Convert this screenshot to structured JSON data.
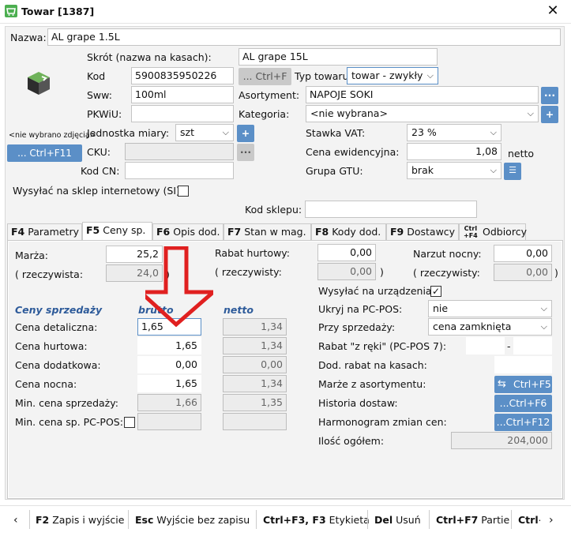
{
  "window": {
    "title": "Towar [1387]"
  },
  "header": {
    "name_label": "Nazwa:",
    "name_value": "AL grape 1.5L"
  },
  "general": {
    "shortname_label": "Skrót (nazwa na kasach):",
    "shortname_value": "AL grape 15L",
    "code_label": "Kod",
    "code_value": "5900835950226",
    "ctrlf_btn": "... Ctrl+F",
    "type_label": "Typ towaru:",
    "type_value": "towar - zwykły",
    "sww_label": "Sww:",
    "sww_value": "100ml",
    "assort_label": "Asortyment:",
    "assort_value": "NAPOJE SOKI",
    "pkwiu_label": "PKWiU:",
    "pkwiu_value": "",
    "category_label": "Kategoria:",
    "category_value": "<nie wybrana>",
    "no_image_text": "<nie wybrano zdjęcia>",
    "image_btn": "... Ctrl+F11",
    "unit_label": "Jednostka miary:",
    "unit_value": "szt",
    "vat_label": "Stawka VAT:",
    "vat_value": "23 %",
    "cku_label": "CKU:",
    "cku_value": "",
    "price_label": "Cena ewidencyjna:",
    "price_value": "1,08",
    "price_suffix": "netto",
    "cn_label": "Kod CN:",
    "cn_value": "",
    "gtu_label": "Grupa GTU:",
    "gtu_value": "brak",
    "ishop_label": "Wysyłać na sklep internetowy (SI):",
    "shopcode_label": "Kod sklepu:",
    "shopcode_value": "",
    "ellipsis": "...",
    "plus": "+"
  },
  "tabs": [
    {
      "key": "F4",
      "label": "Parametry"
    },
    {
      "key": "F5",
      "label": "Ceny sp."
    },
    {
      "key": "F6",
      "label": "Opis dod."
    },
    {
      "key": "F7",
      "label": "Stan w mag."
    },
    {
      "key": "F8",
      "label": "Kody dod."
    },
    {
      "key": "F9",
      "label": "Dostawcy"
    },
    {
      "key1": "Ctrl",
      "key2": "+F4",
      "label": "Odbiorcy"
    }
  ],
  "prices": {
    "margin_label": "Marża:",
    "margin_value": "25,2",
    "real_label": "( rzeczywista:",
    "real_value": "24,0",
    "paren_close": ")",
    "wholesale_disc_label": "Rabat hurtowy:",
    "wholesale_disc_value": "0,00",
    "real2_label": "( rzeczywisty:",
    "real2_value": "0,00",
    "night_markup_label": "Narzut nocny:",
    "night_markup_value": "0,00",
    "real3_label": "( rzeczywisty:",
    "real3_value": "0,00",
    "section_title": "Ceny sprzedaży",
    "brutto_header": "brutto",
    "netto_header": "netto",
    "rows": [
      {
        "label": "Cena detaliczna:",
        "brutto": "1,65",
        "netto": "1,34"
      },
      {
        "label": "Cena hurtowa:",
        "brutto": "1,65",
        "netto": "1,34"
      },
      {
        "label": "Cena dodatkowa:",
        "brutto": "0,00",
        "netto": "0,00"
      },
      {
        "label": "Cena nocna:",
        "brutto": "1,65",
        "netto": "1,34"
      },
      {
        "label": "Min. cena sprzedaży:",
        "brutto": "1,66",
        "netto": "1,35"
      },
      {
        "label": "Min. cena sp. PC-POS:",
        "brutto": "",
        "netto": ""
      }
    ],
    "send_label": "Wysyłać na urządzenia:",
    "hide_label": "Ukryj na PC-POS:",
    "hide_value": "nie",
    "onsale_label": "Przy sprzedaży:",
    "onsale_value": "cena zamknięta",
    "hand_disc_label": "Rabat \"z ręki\" (PC-POS 7):",
    "hand_disc_dash": "-",
    "cash_disc_label": "Dod. rabat na kasach:",
    "assort_margin_label": "Marże z asortymentu:",
    "assort_margin_btn": "Ctrl+F5",
    "deliv_hist_label": "Historia dostaw:",
    "deliv_hist_btn": "...Ctrl+F6",
    "schedule_label": "Harmonogram zmian cen:",
    "schedule_btn": "...Ctrl+F12",
    "qty_label": "Ilość ogółem:",
    "qty_value": "204,000"
  },
  "footer": [
    {
      "key": "F2",
      "label": "Zapis i wyjście"
    },
    {
      "key": "Esc",
      "label": "Wyjście bez zapisu"
    },
    {
      "key": "Ctrl+F3, F3",
      "label": "Etykieta"
    },
    {
      "key": "Del",
      "label": "Usuń"
    },
    {
      "key": "Ctrl+F7",
      "label": "Partie"
    },
    {
      "key": "Ctrl+",
      "label": ""
    }
  ],
  "colors": {
    "accent": "#5b8fc7",
    "arrow": "#e02020",
    "app_icon": "#4caf50"
  }
}
